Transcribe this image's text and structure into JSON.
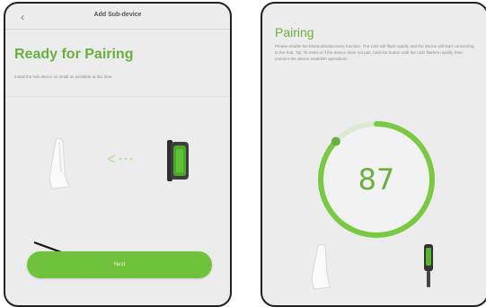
{
  "screen_left": {
    "nav": {
      "back_icon": "chevron-left-icon",
      "back_glyph": "‹",
      "title": "Add Sub-device"
    },
    "title": "Ready for Pairing",
    "instruction": "Install the hub device on small as available at this time.",
    "next_button_label": "Next"
  },
  "screen_right": {
    "title": "Pairing",
    "instruction": "Please enable the bluetooth/discovery function. The LED will flash rapidly and the device will start connecting to the hub. Tip: To reset or if the device does not pair, hold the button until the LED flashes rapidly, then connect the device establish operations.",
    "progress_value": "87",
    "progress_fraction": 0.87
  },
  "colors": {
    "accent": "#6ab03f",
    "button": "#6fc23c"
  }
}
